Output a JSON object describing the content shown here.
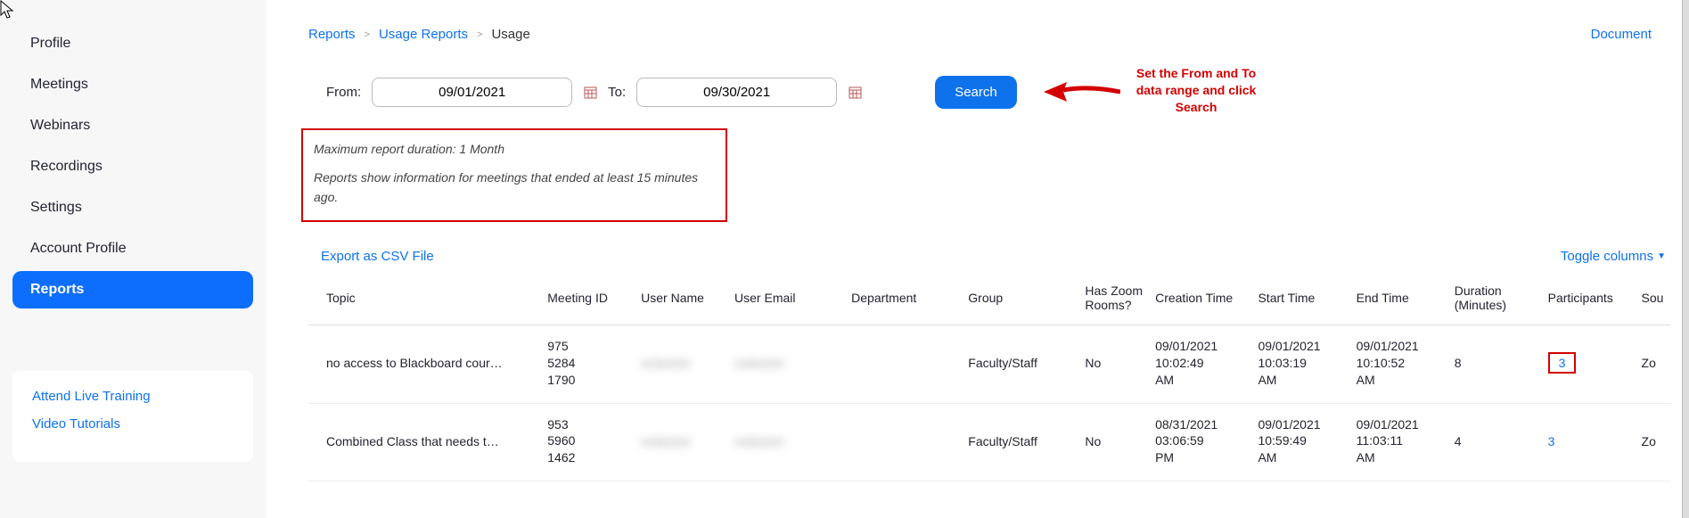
{
  "sidebar": {
    "items": [
      {
        "label": "Profile"
      },
      {
        "label": "Meetings"
      },
      {
        "label": "Webinars"
      },
      {
        "label": "Recordings"
      },
      {
        "label": "Settings"
      },
      {
        "label": "Account Profile"
      },
      {
        "label": "Reports"
      }
    ],
    "help": {
      "training": "Attend Live Training",
      "tutorials": "Video Tutorials"
    }
  },
  "breadcrumb": {
    "l1": "Reports",
    "l2": "Usage Reports",
    "l3": "Usage"
  },
  "doc_link": "Document",
  "daterange": {
    "from_label": "From:",
    "from_value": "09/01/2021",
    "to_label": "To:",
    "to_value": "09/30/2021",
    "search": "Search"
  },
  "annotation": {
    "line1": "Set the From and To",
    "line2": "data range and click",
    "line3": "Search"
  },
  "info": {
    "line1": "Maximum report duration: 1 Month",
    "line2": "Reports show information for meetings that ended at least 15 minutes ago."
  },
  "table_toolbar": {
    "export": "Export as CSV File",
    "toggle": "Toggle columns"
  },
  "table": {
    "headers": {
      "topic": "Topic",
      "meeting_id": "Meeting ID",
      "user_name": "User Name",
      "user_email": "User Email",
      "department": "Department",
      "group": "Group",
      "has_zoom_rooms": "Has Zoom Rooms?",
      "creation_time": "Creation Time",
      "start_time": "Start Time",
      "end_time": "End Time",
      "duration": "Duration (Minutes)",
      "participants": "Participants",
      "source": "Sou"
    },
    "rows": [
      {
        "topic": "no access to Blackboard cour…",
        "meeting_id": "975 5284 1790",
        "user_name": "redacted",
        "user_email": "redacted",
        "department": "",
        "group": "Faculty/Staff",
        "has_zoom_rooms": "No",
        "creation_time": "09/01/2021 10:02:49 AM",
        "start_time": "09/01/2021 10:03:19 AM",
        "end_time": "09/01/2021 10:10:52 AM",
        "duration": "8",
        "participants": "3",
        "participants_highlight": true,
        "source": "Zo"
      },
      {
        "topic": "Combined Class that needs t…",
        "meeting_id": "953 5960 1462",
        "user_name": "redacted",
        "user_email": "redacted",
        "department": "",
        "group": "Faculty/Staff",
        "has_zoom_rooms": "No",
        "creation_time": "08/31/2021 03:06:59 PM",
        "start_time": "09/01/2021 10:59:49 AM",
        "end_time": "09/01/2021 11:03:11 AM",
        "duration": "4",
        "participants": "3",
        "participants_highlight": false,
        "source": "Zo"
      }
    ]
  }
}
